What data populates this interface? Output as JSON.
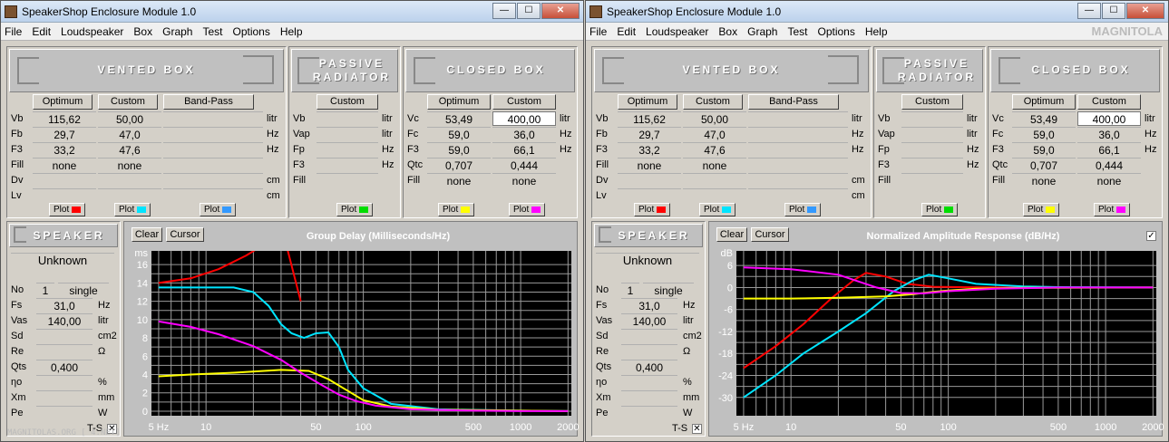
{
  "windows": [
    {
      "title": "SpeakerShop Enclosure Module 1.0",
      "menu": [
        "File",
        "Edit",
        "Loudspeaker",
        "Box",
        "Graph",
        "Test",
        "Options",
        "Help"
      ],
      "sections": {
        "vented": "VENTED BOX",
        "passive": "PASSIVE RADIATOR",
        "closed": "CLOSED BOX",
        "speaker": "SPEAKER"
      },
      "vented": {
        "tabs": [
          "Optimum",
          "Custom",
          "Band-Pass"
        ],
        "rows": [
          {
            "label": "Vb",
            "optimum": "115,62",
            "custom": "50,00",
            "unit": "litr"
          },
          {
            "label": "Fb",
            "optimum": "29,7",
            "custom": "47,0",
            "unit": "Hz"
          },
          {
            "label": "F3",
            "optimum": "33,2",
            "custom": "47,6",
            "unit": "Hz"
          },
          {
            "label": "Fill",
            "optimum": "none",
            "custom": "none",
            "unit": ""
          },
          {
            "label": "Dv",
            "optimum": "",
            "custom": "",
            "unit": "cm"
          },
          {
            "label": "Lv",
            "optimum": "",
            "custom": "",
            "unit": "cm"
          }
        ]
      },
      "passive": {
        "tab": "Custom",
        "rows": [
          {
            "label": "Vb",
            "unit": "litr"
          },
          {
            "label": "Vap",
            "unit": "litr"
          },
          {
            "label": "Fp",
            "unit": "Hz"
          },
          {
            "label": "F3",
            "unit": "Hz"
          },
          {
            "label": "Fill",
            "unit": ""
          }
        ]
      },
      "closed": {
        "tabs": [
          "Optimum",
          "Custom"
        ],
        "rows": [
          {
            "label": "Vc",
            "optimum": "53,49",
            "custom": "400,00",
            "unit": "litr"
          },
          {
            "label": "Fc",
            "optimum": "59,0",
            "custom": "36,0",
            "unit": "Hz"
          },
          {
            "label": "F3",
            "optimum": "59,0",
            "custom": "66,1",
            "unit": "Hz"
          },
          {
            "label": "Qtc",
            "optimum": "0,707",
            "custom": "0,444",
            "unit": ""
          },
          {
            "label": "Fill",
            "optimum": "none",
            "custom": "none",
            "unit": ""
          }
        ]
      },
      "plot_label": "Plot",
      "plot_colors": [
        "#ff0000",
        "#00e5ff",
        "#3399ff",
        "#00dd00",
        "#ffff00",
        "#ff00ff"
      ],
      "speaker": {
        "name": "Unknown",
        "count": "1",
        "mode": "single",
        "rows": [
          {
            "label": "No",
            "value": "",
            "unit": ""
          },
          {
            "label": "Fs",
            "value": "31,0",
            "unit": "Hz"
          },
          {
            "label": "Vas",
            "value": "140,00",
            "unit": "litr"
          },
          {
            "label": "Sd",
            "value": "",
            "unit": "cm2"
          },
          {
            "label": "Re",
            "value": "",
            "unit": "Ω"
          },
          {
            "label": "Qts",
            "value": "0,400",
            "unit": ""
          },
          {
            "label": "ηo",
            "value": "",
            "unit": "%"
          },
          {
            "label": "Xm",
            "value": "",
            "unit": "mm"
          },
          {
            "label": "Pe",
            "value": "",
            "unit": "W"
          }
        ],
        "ts_label": "T-S"
      },
      "graph": {
        "clear": "Clear",
        "cursor": "Cursor",
        "title": "Group Delay (Milliseconds/Hz)",
        "yunit": "ms",
        "yticks": [
          "16",
          "14",
          "12",
          "10",
          "8",
          "6",
          "4",
          "2",
          "0"
        ],
        "xticks": [
          "5 Hz",
          "10",
          "50",
          "100",
          "500",
          "1000",
          "2000"
        ]
      },
      "watermark": "MAGNITOLAS.ORG  [   4.NET]"
    },
    {
      "title": "SpeakerShop Enclosure Module 1.0",
      "menu": [
        "File",
        "Edit",
        "Loudspeaker",
        "Box",
        "Graph",
        "Test",
        "Options",
        "Help"
      ],
      "graph": {
        "clear": "Clear",
        "cursor": "Cursor",
        "title": "Normalized Amplitude Response (dB/Hz)",
        "yunit": "dB",
        "yticks": [
          "6",
          "0",
          "-6",
          "-12",
          "-18",
          "-24",
          "-30"
        ],
        "xticks": [
          "5 Hz",
          "10",
          "50",
          "100",
          "500",
          "1000",
          "2000"
        ]
      },
      "logo_text": "MAGNITOLA"
    }
  ],
  "chart_data": [
    {
      "type": "line",
      "title": "Group Delay (Milliseconds/Hz)",
      "ylabel": "ms",
      "xscale": "log",
      "xlim": [
        4.5,
        2100
      ],
      "ylim": [
        -0.5,
        17.5
      ],
      "grid": true,
      "series": [
        {
          "color": "#ff0000",
          "x": [
            5,
            8,
            12,
            18,
            25,
            32,
            40
          ],
          "y": [
            14,
            14.5,
            15.5,
            17,
            18.5,
            18.5,
            12
          ]
        },
        {
          "color": "#00e5ff",
          "x": [
            5,
            8,
            15,
            20,
            25,
            30,
            35,
            42,
            50,
            60,
            70,
            80,
            100,
            150,
            300,
            1000,
            2000
          ],
          "y": [
            13.5,
            13.5,
            13.5,
            13,
            11.5,
            9.5,
            8.5,
            8,
            8.5,
            8.6,
            7,
            4.5,
            2.5,
            0.8,
            0.2,
            0.05,
            0
          ]
        },
        {
          "color": "#ffff00",
          "x": [
            5,
            8,
            15,
            30,
            45,
            60,
            80,
            100,
            150,
            300,
            1000,
            2000
          ],
          "y": [
            3.8,
            4,
            4.2,
            4.5,
            4.4,
            3.5,
            2.2,
            1.2,
            0.5,
            0.15,
            0.05,
            0
          ]
        },
        {
          "color": "#ff00ff",
          "x": [
            5,
            8,
            12,
            20,
            30,
            40,
            55,
            70,
            90,
            120,
            200,
            500,
            1000,
            2000
          ],
          "y": [
            9.8,
            9.2,
            8.4,
            7.1,
            5.6,
            4.2,
            2.8,
            1.8,
            1.1,
            0.6,
            0.2,
            0.05,
            0,
            0
          ]
        }
      ]
    },
    {
      "type": "line",
      "title": "Normalized Amplitude Response (dB/Hz)",
      "ylabel": "dB",
      "xscale": "log",
      "xlim": [
        4.5,
        2100
      ],
      "ylim": [
        -35,
        10
      ],
      "grid": true,
      "series": [
        {
          "color": "#ff0000",
          "x": [
            5,
            8,
            12,
            18,
            25,
            30,
            40,
            55,
            80,
            120,
            200,
            500,
            2000
          ],
          "y": [
            -22,
            -16,
            -10,
            -3,
            2,
            4,
            3,
            1,
            0.2,
            0.1,
            0,
            0,
            0
          ]
        },
        {
          "color": "#00e5ff",
          "x": [
            5,
            8,
            12,
            20,
            30,
            45,
            60,
            75,
            100,
            150,
            300,
            500,
            2000
          ],
          "y": [
            -30,
            -24,
            -18,
            -12,
            -7,
            -1,
            2,
            3.5,
            2.5,
            1,
            0.3,
            0.1,
            0
          ]
        },
        {
          "color": "#ffff00",
          "x": [
            5,
            10,
            20,
            40,
            60,
            80,
            100,
            150,
            300,
            2000
          ],
          "y": [
            -3,
            -3,
            -2.8,
            -2.4,
            -1.8,
            -1.2,
            -0.8,
            -0.3,
            -0.1,
            0
          ]
        },
        {
          "color": "#ff00ff",
          "x": [
            5,
            10,
            20,
            35,
            50,
            70,
            100,
            200,
            500,
            2000
          ],
          "y": [
            5.5,
            5,
            3.5,
            0,
            -1.5,
            -1.6,
            -1,
            -0.3,
            0,
            0
          ]
        }
      ]
    }
  ]
}
